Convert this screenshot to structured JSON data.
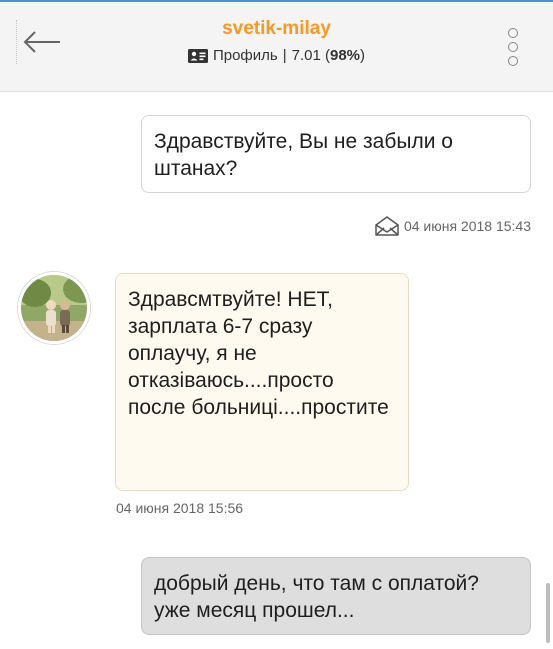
{
  "header": {
    "username": "svetik-milay",
    "profile_label": "Профиль",
    "separator": "|",
    "rating": "7.01",
    "percent_open": "(",
    "percent": "98%",
    "percent_close": ")",
    "back_icon": "arrow-left-icon",
    "menu_icon": "more-vertical-icon",
    "accent_color": "#f59a23"
  },
  "messages": [
    {
      "direction": "outgoing",
      "text": "Здравствуйте, Вы не забыли о штанах?",
      "time": "04 июня 2018 15:43",
      "status_icon": "envelope-open-icon"
    },
    {
      "direction": "incoming",
      "text": "Здравсмтвуйте! НЕТ, зарплата 6-7 сразу оплаучу, я не отказіваюсь....просто после больниці....простите",
      "time": "04 июня 2018 15:56"
    },
    {
      "direction": "outgoing",
      "text": "добрый день, что там с оплатой? уже месяц прошел..."
    }
  ]
}
